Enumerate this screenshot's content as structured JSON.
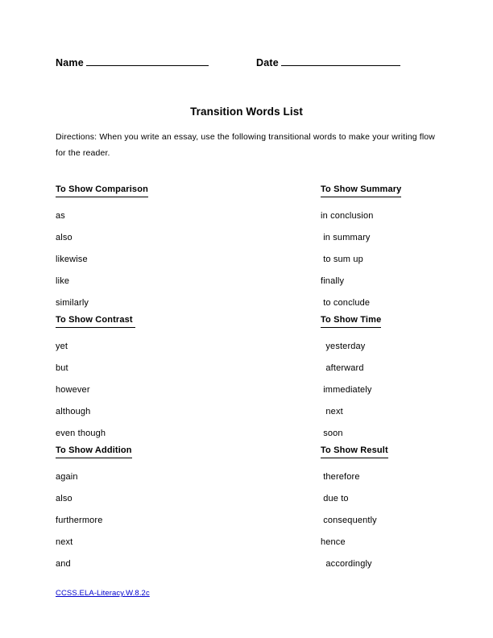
{
  "document": {
    "title": "Transition Words List",
    "directions": "Directions: When you write an essay, use the following transitional words to make your writing flow for the reader."
  },
  "fields": {
    "name_label": "Name",
    "date_label": "Date"
  },
  "columns": {
    "left": [
      {
        "heading": "To Show Comparison",
        "items": [
          "as",
          "also",
          "likewise",
          "like",
          "similarly"
        ]
      },
      {
        "heading": "To Show Contrast ",
        "items": [
          "yet",
          "but",
          "however",
          "although",
          "even though"
        ]
      },
      {
        "heading": "To Show Addition",
        "items": [
          "again",
          "also",
          "furthermore",
          "next",
          "and"
        ]
      }
    ],
    "right": [
      {
        "heading": "To Show Summary",
        "items": [
          "in conclusion",
          " in summary",
          " to sum up",
          "finally",
          " to conclude"
        ]
      },
      {
        "heading": "To Show Time",
        "items": [
          "  yesterday",
          "  afterward",
          " immediately",
          "  next",
          " soon"
        ]
      },
      {
        "heading": "To Show Result",
        "items": [
          " therefore",
          " due to",
          " consequently",
          "hence",
          "  accordingly"
        ]
      }
    ]
  },
  "footer": {
    "standard_link": "CCSS.ELA-Literacy.W.8.2c"
  },
  "colors": {
    "text": "#000000",
    "link": "#0000cc",
    "background": "#ffffff"
  }
}
